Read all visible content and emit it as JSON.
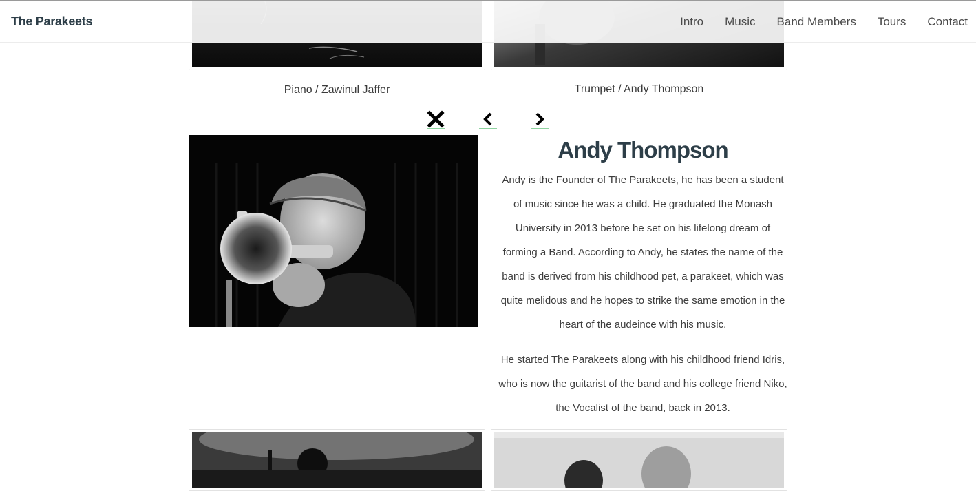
{
  "header": {
    "brand": "The Parakeets",
    "nav": [
      "Intro",
      "Music",
      "Band Members",
      "Tours",
      "Contact"
    ]
  },
  "gallery": {
    "captions": [
      "Piano / Zawinul Jaffer",
      "Trumpet / Andy Thompson"
    ]
  },
  "controls": {
    "close_icon": "close-icon",
    "prev_icon": "chevron-left-icon",
    "next_icon": "chevron-right-icon",
    "accent": "#8fd3a0"
  },
  "detail": {
    "name": "Andy Thompson",
    "paragraphs": [
      "Andy is the Founder of The Parakeets, he has been a student of music since he was a child. He graduated the Monash University in 2013 before he set on his lifelong dream of forming a Band. According to Andy, he states the name of the band is derived from his childhood pet, a parakeet, which was quite melidous and he hopes to strike the same emotion in the heart of the audeince with his music.",
      "He started The Parakeets along with his childhood friend Idris, who is now the guitarist of the band and his college friend Niko, the Vocalist of the band, back in 2013."
    ]
  },
  "colors": {
    "brand_text": "#2d3e48",
    "background": "#ffffff"
  }
}
